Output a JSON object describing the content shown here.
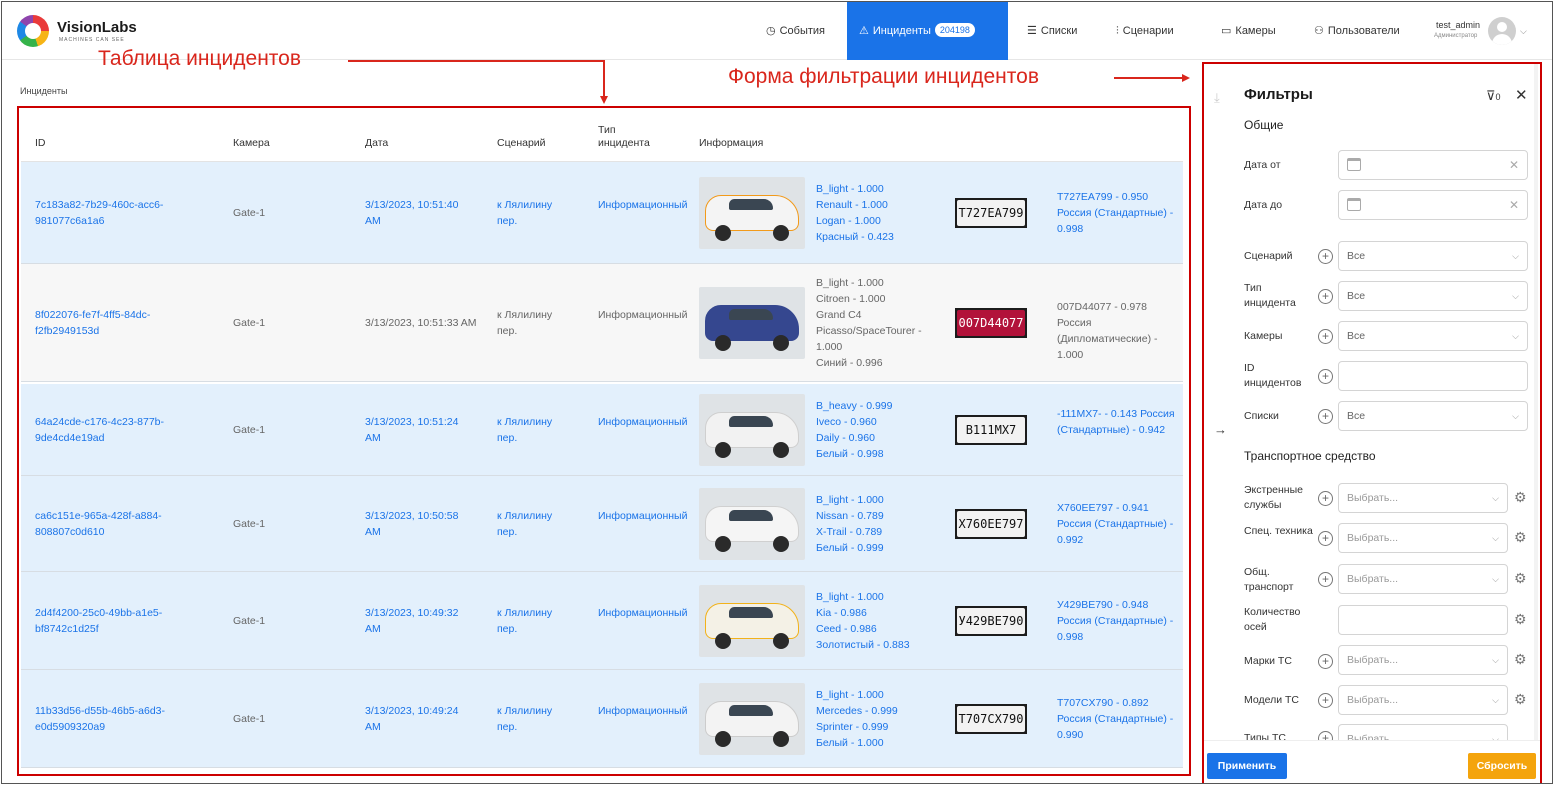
{
  "header": {
    "brand": "VisionLabs",
    "tagline": "MACHINES CAN SEE",
    "nav": [
      {
        "label": "События",
        "icon": "clock-icon"
      },
      {
        "label": "Инциденты",
        "icon": "warning-icon",
        "badge": "204198",
        "active": true
      },
      {
        "label": "Списки",
        "icon": "list-icon"
      },
      {
        "label": "Сценарии",
        "icon": "sliders-icon"
      },
      {
        "label": "Камеры",
        "icon": "camera-icon"
      },
      {
        "label": "Пользователи",
        "icon": "users-icon"
      }
    ],
    "user": {
      "name": "test_admin",
      "role": "Администратор"
    }
  },
  "annotations": {
    "table": "Таблица инцидентов",
    "filter": "Форма фильтрации инцидентов"
  },
  "breadcrumb": "Инциденты",
  "table": {
    "columns": [
      "ID",
      "Камера",
      "Дата",
      "Сценарий",
      "Тип инцидента",
      "Информация"
    ],
    "rows": [
      {
        "id": "7c183a82-7b29-460c-acc6-981077c6a1a6",
        "camera": "Gate-1",
        "date": "3/13/2023, 10:51:40 AM",
        "scenario": "к Лялилину пер.",
        "type": "Информационный",
        "info": [
          "B_light - 1.000",
          "Renault - 1.000",
          "Logan - 1.000",
          "Красный - 0.423"
        ],
        "plate": "T727EA799",
        "plate_info": "T727EA799 - 0.950 Россия (Стандартные) - 0.998",
        "car_color": "#f4f4f4",
        "accent": "#f29a1a"
      },
      {
        "id": "8f022076-fe7f-4ff5-84dc-f2fb2949153d",
        "camera": "Gate-1",
        "date": "3/13/2023, 10:51:33 AM",
        "scenario": "к Лялилину пер.",
        "type": "Информационный",
        "info": [
          "B_light - 1.000",
          "Citroen - 1.000",
          "Grand C4",
          "Picasso/SpaceTourer -",
          "1.000",
          "Синий - 0.996"
        ],
        "plate": "007D44077",
        "plate_info": "007D44077 - 0.978 Россия (Дипломатические) - 1.000",
        "car_color": "#35478f",
        "accent": "#35478f"
      },
      {
        "id": "64a24cde-c176-4c23-877b-9de4cd4e19ad",
        "camera": "Gate-1",
        "date": "3/13/2023, 10:51:24 AM",
        "scenario": "к Лялилину пер.",
        "type": "Информационный",
        "info": [
          "B_heavy - 0.999",
          "Iveco - 0.960",
          "Daily - 0.960",
          "Белый - 0.998"
        ],
        "plate": "B111MX7",
        "plate_info": "-111MX7- - 0.143 Россия (Стандартные) - 0.942",
        "car_color": "#f2f2f2",
        "accent": "#cfcfcf"
      },
      {
        "id": "ca6c151e-965a-428f-a884-808807c0d610",
        "camera": "Gate-1",
        "date": "3/13/2023, 10:50:58 AM",
        "scenario": "к Лялилину пер.",
        "type": "Информационный",
        "info": [
          "B_light - 1.000",
          "Nissan - 0.789",
          "X-Trail - 0.789",
          "Белый - 0.999"
        ],
        "plate": "X760EE797",
        "plate_info": "X760EE797 - 0.941 Россия (Стандартные) - 0.992",
        "car_color": "#f5f5f5",
        "accent": "#d0d0d0"
      },
      {
        "id": "2d4f4200-25c0-49bb-a1e5-bf8742c1d25f",
        "camera": "Gate-1",
        "date": "3/13/2023, 10:49:32 AM",
        "scenario": "к Лялилину пер.",
        "type": "Информационный",
        "info": [
          "B_light - 1.000",
          "Kia - 0.986",
          "Ceed - 0.986",
          "Золотистый - 0.883"
        ],
        "plate": "У429ВЕ790",
        "plate_info": "У429ВЕ790 - 0.948 Россия (Стандартные) - 0.998",
        "car_color": "#f4f1e6",
        "accent": "#f2b21a"
      },
      {
        "id": "11b33d56-d55b-46b5-a6d3-e0d5909320a9",
        "camera": "Gate-1",
        "date": "3/13/2023, 10:49:24 AM",
        "scenario": "к Лялилину пер.",
        "type": "Информационный",
        "info": [
          "B_light - 1.000",
          "Mercedes - 0.999",
          "Sprinter - 0.999",
          "Белый - 1.000"
        ],
        "plate": "T707CX790",
        "plate_info": "T707CX790 - 0.892 Россия (Стандартные) - 0.990",
        "car_color": "#f3f3f3",
        "accent": "#cccccc"
      }
    ]
  },
  "filters": {
    "title": "Фильтры",
    "filter_count": "0",
    "section_general": "Общие",
    "section_vehicle": "Транспортное средство",
    "date_from_label": "Дата от",
    "date_to_label": "Дата до",
    "scenario_label": "Сценарий",
    "scenario_value": "Все",
    "type_label": "Тип инцидента",
    "type_value": "Все",
    "cameras_label": "Камеры",
    "cameras_value": "Все",
    "ids_label": "ID инцидентов",
    "lists_label": "Списки",
    "lists_value": "Все",
    "emergency_label": "Экстренные службы",
    "special_label": "Спец. техника",
    "public_label": "Общ. транспорт",
    "axles_label": "Количество осей",
    "brands_label": "Марки ТС",
    "models_label": "Модели ТС",
    "types_label": "Типы ТС",
    "select_placeholder": "Выбрать...",
    "apply": "Применить",
    "reset": "Сбросить"
  }
}
